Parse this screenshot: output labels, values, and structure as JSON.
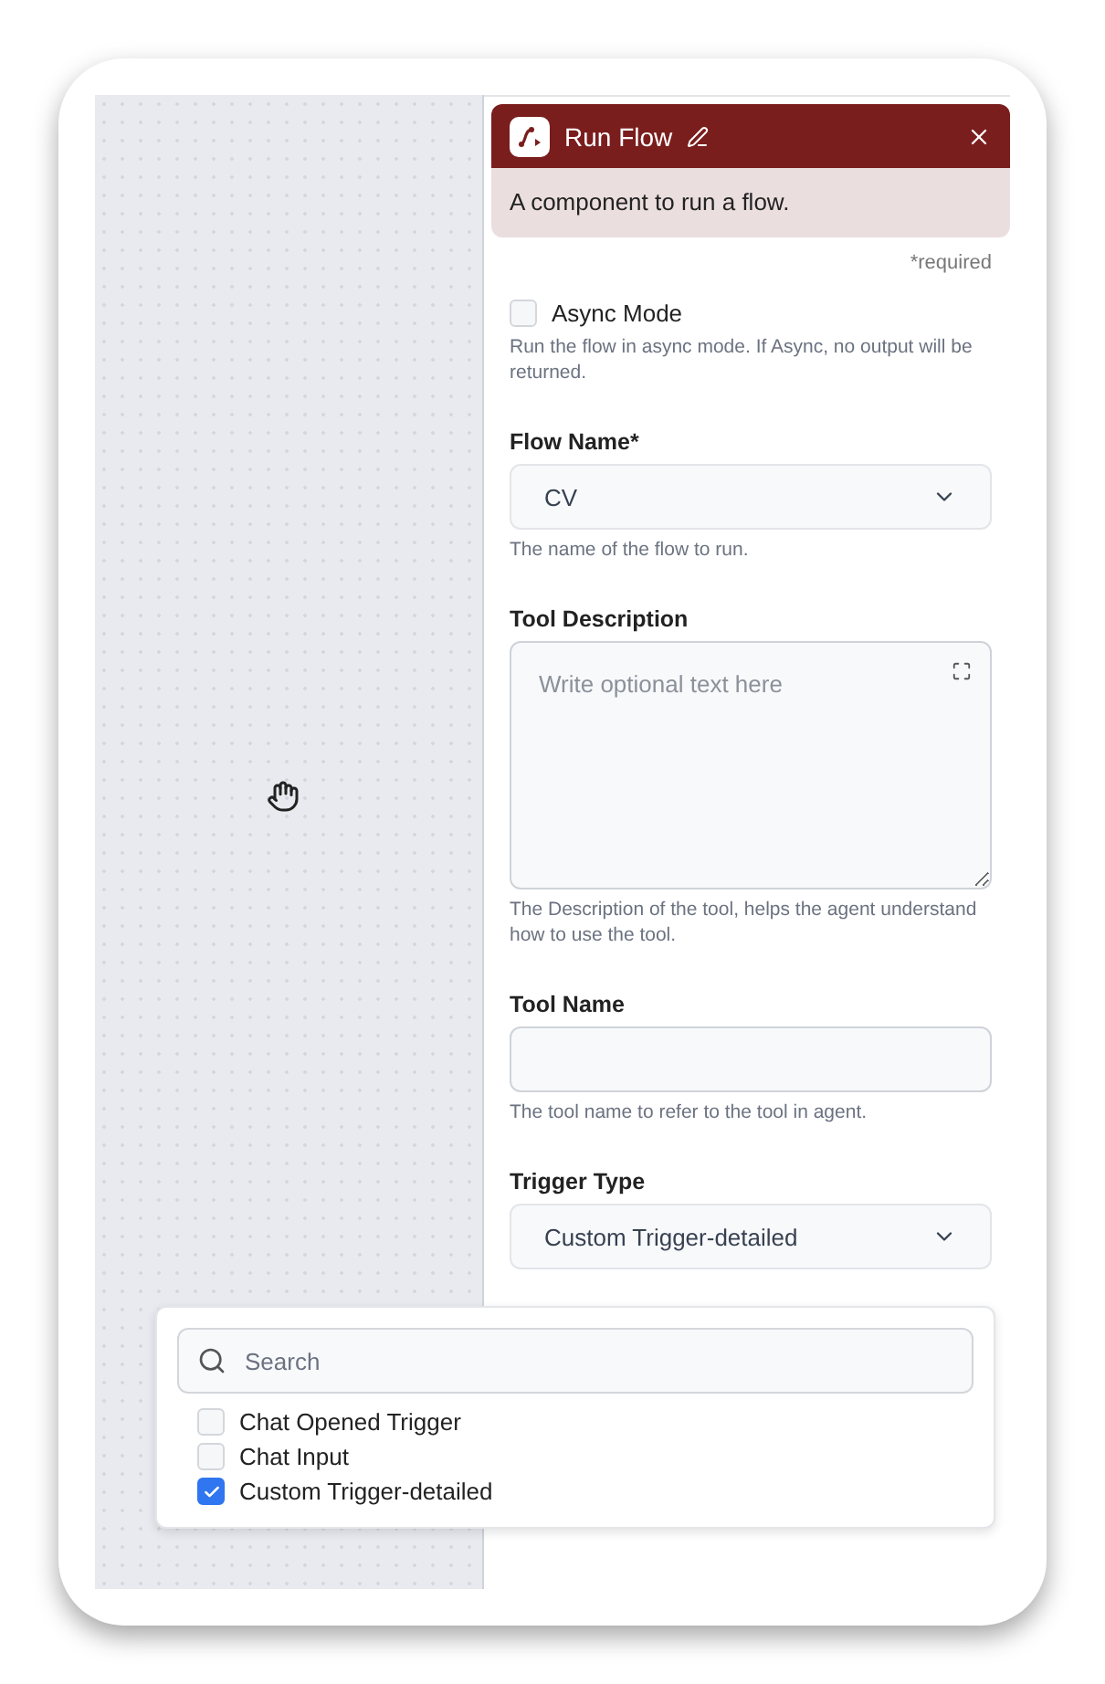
{
  "panel": {
    "title": "Run Flow",
    "description": "A component to run a flow.",
    "required_note": "*required",
    "fields": [
      {
        "kind": "checkbox",
        "label": "Async Mode",
        "checked": false,
        "hint": "Run the flow in async mode. If Async, no output will be returned."
      },
      {
        "kind": "select",
        "label": "Flow Name*",
        "value": "CV",
        "hint": "The name of the flow to run."
      },
      {
        "kind": "textarea",
        "label": "Tool Description",
        "placeholder": "Write optional text here",
        "hint": "The Description of the tool, helps the agent understand how to use the tool."
      },
      {
        "kind": "input",
        "label": "Tool Name",
        "hint": "The tool name to refer to the tool in agent."
      },
      {
        "kind": "select",
        "label": "Trigger Type",
        "value": "Custom Trigger-detailed"
      }
    ]
  },
  "dropdown": {
    "search_placeholder": "Search",
    "options": [
      {
        "label": "Chat Opened Trigger",
        "checked": false
      },
      {
        "label": "Chat Input",
        "checked": false
      },
      {
        "label": "Custom Trigger-detailed",
        "checked": true
      }
    ]
  }
}
